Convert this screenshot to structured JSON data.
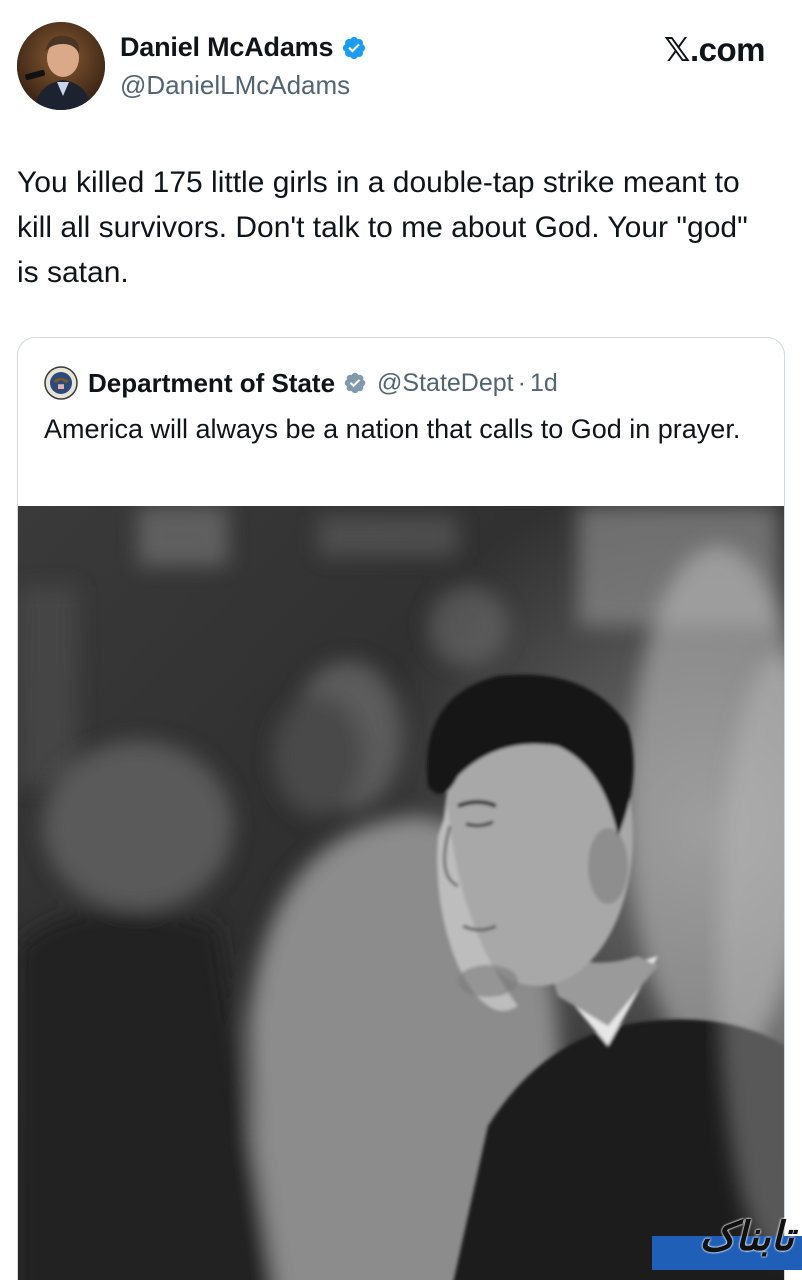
{
  "author": {
    "display_name": "Daniel McAdams",
    "handle": "@DanielLMcAdams",
    "verified_icon": "verified-badge-icon"
  },
  "site": {
    "label": "𝕏.com"
  },
  "tweet": {
    "text": "You killed 175 little girls in a double-tap strike meant to kill all survivors. Don't talk to me about God. Your \"god\" is satan."
  },
  "quoted": {
    "display_name": "Department of State",
    "handle": "@StateDept",
    "separator": "·",
    "time": "1d",
    "text": "America will always be a nation that calls to God in prayer."
  },
  "watermark": {
    "text": "تابناک"
  },
  "colors": {
    "text": "#0f1419",
    "secondary": "#536471",
    "verified_blue": "#1d9bf0",
    "government_gray": "#829aab",
    "border": "#cfd9de"
  }
}
